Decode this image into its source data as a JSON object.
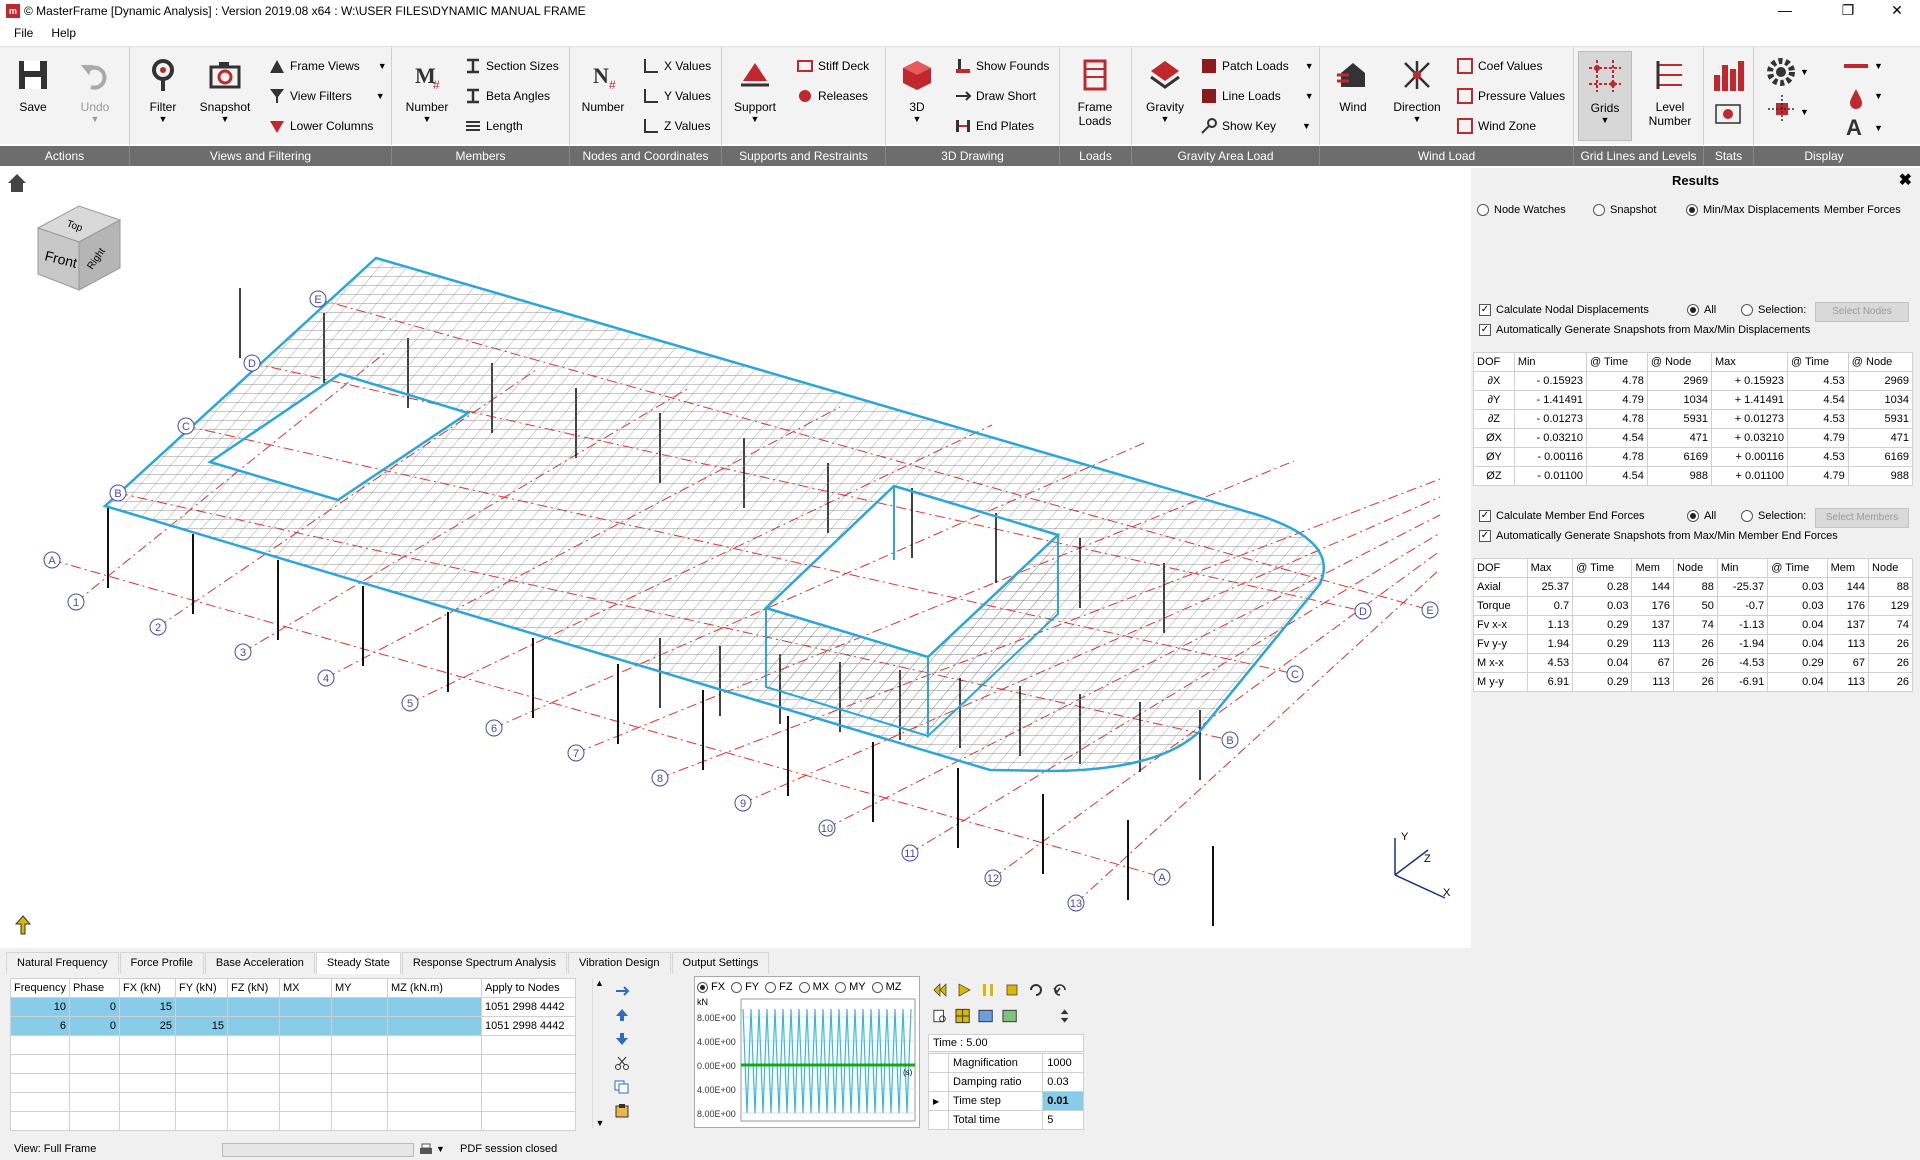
{
  "window": {
    "title": "© MasterFrame [Dynamic Analysis] : Version 2019.08 x64 : W:\\USER FILES\\DYNAMIC MANUAL FRAME"
  },
  "menu": [
    "File",
    "Help"
  ],
  "ribbon": {
    "actions": {
      "label": "Actions",
      "save": "Save",
      "undo": "Undo"
    },
    "views": {
      "label": "Views and Filtering",
      "filter": "Filter",
      "snapshot": "Snapshot",
      "frame_views": "Frame Views",
      "view_filters": "View Filters",
      "lower_columns": "Lower Columns"
    },
    "members": {
      "label": "Members",
      "number": "Number",
      "section_sizes": "Section Sizes",
      "beta_angles": "Beta Angles",
      "length": "Length"
    },
    "nodes": {
      "label": "Nodes and Coordinates",
      "number": "Number",
      "x_values": "X Values",
      "y_values": "Y Values",
      "z_values": "Z Values"
    },
    "supports": {
      "label": "Supports and Restraints",
      "support": "Support",
      "stiff_deck": "Stiff Deck",
      "releases": "Releases"
    },
    "drawing": {
      "label": "3D Drawing",
      "three_d": "3D",
      "show_founds": "Show Founds",
      "draw_short": "Draw Short",
      "end_plates": "End Plates"
    },
    "loads": {
      "label": "Loads",
      "frame_loads_1": "Frame",
      "frame_loads_2": "Loads"
    },
    "gravity": {
      "label": "Gravity Area Load",
      "gravity": "Gravity",
      "patch_loads": "Patch Loads",
      "line_loads": "Line Loads",
      "show_key": "Show Key"
    },
    "wind": {
      "label": "Wind Load",
      "wind": "Wind",
      "direction": "Direction",
      "coef_values": "Coef Values",
      "pressure_values": "Pressure Values",
      "wind_zone": "Wind Zone"
    },
    "grids": {
      "label": "Grid Lines and Levels",
      "grids": "Grids",
      "level_1": "Level",
      "level_2": "Number"
    },
    "stats": {
      "label": "Stats"
    },
    "display": {
      "label": "Display"
    }
  },
  "viewcube": {
    "top": "Top",
    "front": "Front",
    "right": "Right"
  },
  "grid_labels": {
    "numbers": [
      "1",
      "2",
      "3",
      "4",
      "5",
      "6",
      "7",
      "8",
      "9",
      "10",
      "11",
      "12",
      "13"
    ],
    "letters": [
      "A",
      "B",
      "C",
      "D",
      "E"
    ]
  },
  "axes": {
    "x": "X",
    "y": "Y",
    "z": "Z"
  },
  "results": {
    "title": "Results",
    "view_options": [
      "Node Watches",
      "Snapshot",
      "Min/Max Displacements",
      "Member Forces"
    ],
    "nodal": {
      "calc_label": "Calculate Nodal Displacements",
      "auto_label": "Automatically Generate Snapshots from Max/Min Displacements",
      "all": "All",
      "selection": "Selection:",
      "select_btn": "Select Nodes",
      "headers": [
        "DOF",
        "Min",
        "@ Time",
        "@ Node",
        "Max",
        "@ Time",
        "@ Node"
      ],
      "rows": [
        [
          "∂X",
          "- 0.15923",
          "4.78",
          "2969",
          "+ 0.15923",
          "4.53",
          "2969"
        ],
        [
          "∂Y",
          "- 1.41491",
          "4.79",
          "1034",
          "+ 1.41491",
          "4.54",
          "1034"
        ],
        [
          "∂Z",
          "- 0.01273",
          "4.78",
          "5931",
          "+ 0.01273",
          "4.53",
          "5931"
        ],
        [
          "ØX",
          "- 0.03210",
          "4.54",
          "471",
          "+ 0.03210",
          "4.79",
          "471"
        ],
        [
          "ØY",
          "- 0.00116",
          "4.78",
          "6169",
          "+ 0.00116",
          "4.53",
          "6169"
        ],
        [
          "ØZ",
          "- 0.01100",
          "4.54",
          "988",
          "+ 0.01100",
          "4.79",
          "988"
        ]
      ]
    },
    "member": {
      "calc_label": "Calculate Member End Forces",
      "auto_label": "Automatically Generate Snapshots from Max/Min Member End Forces",
      "all": "All",
      "selection": "Selection:",
      "select_btn": "Select Members",
      "headers": [
        "DOF",
        "Max",
        "@ Time",
        "Mem",
        "Node",
        "Min",
        "@ Time",
        "Mem",
        "Node"
      ],
      "rows": [
        [
          "Axial",
          "25.37",
          "0.28",
          "144",
          "88",
          "-25.37",
          "0.03",
          "144",
          "88"
        ],
        [
          "Torque",
          "0.7",
          "0.03",
          "176",
          "50",
          "-0.7",
          "0.03",
          "176",
          "129"
        ],
        [
          "Fv x-x",
          "1.13",
          "0.29",
          "137",
          "74",
          "-1.13",
          "0.04",
          "137",
          "74"
        ],
        [
          "Fv y-y",
          "1.94",
          "0.29",
          "113",
          "26",
          "-1.94",
          "0.04",
          "113",
          "26"
        ],
        [
          "M x-x",
          "4.53",
          "0.04",
          "67",
          "26",
          "-4.53",
          "0.29",
          "67",
          "26"
        ],
        [
          "M y-y",
          "6.91",
          "0.29",
          "113",
          "26",
          "-6.91",
          "0.04",
          "113",
          "26"
        ]
      ]
    }
  },
  "bottom": {
    "tabs": [
      "Natural Frequency",
      "Force Profile",
      "Base Acceleration",
      "Steady State",
      "Response Spectrum Analysis",
      "Vibration Design",
      "Output Settings"
    ],
    "active_tab": "Steady State",
    "forcing": {
      "headers": [
        "Frequency",
        "Phase",
        "FX (kN)",
        "FY (kN)",
        "FZ (kN)",
        "MX",
        "MY",
        "MZ (kN.m)",
        "Apply to Nodes"
      ],
      "rows": [
        [
          "10",
          "0",
          "15",
          "",
          "",
          "",
          "",
          "",
          "1051 2998 4442"
        ],
        [
          "6",
          "0",
          "25",
          "15",
          "",
          "",
          "",
          "",
          "1051 2998 4442"
        ]
      ]
    },
    "graph": {
      "dof_options": [
        "FX",
        "FY",
        "FZ",
        "MX",
        "MY",
        "MZ"
      ],
      "unit": "kN",
      "ticks": [
        "8.00E+00",
        "4.00E+00",
        "0.00E+00",
        "4.00E+00",
        "8.00E+00"
      ],
      "marker": "(s)"
    },
    "time_label": "Time : 5.00",
    "props": [
      [
        "Magnification",
        "1000"
      ],
      [
        "Damping ratio",
        "0.03"
      ],
      [
        "Time step",
        "0.01"
      ],
      [
        "Total time",
        "5"
      ]
    ]
  },
  "status": {
    "view": "View: Full Frame",
    "pdf": "PDF session closed"
  }
}
